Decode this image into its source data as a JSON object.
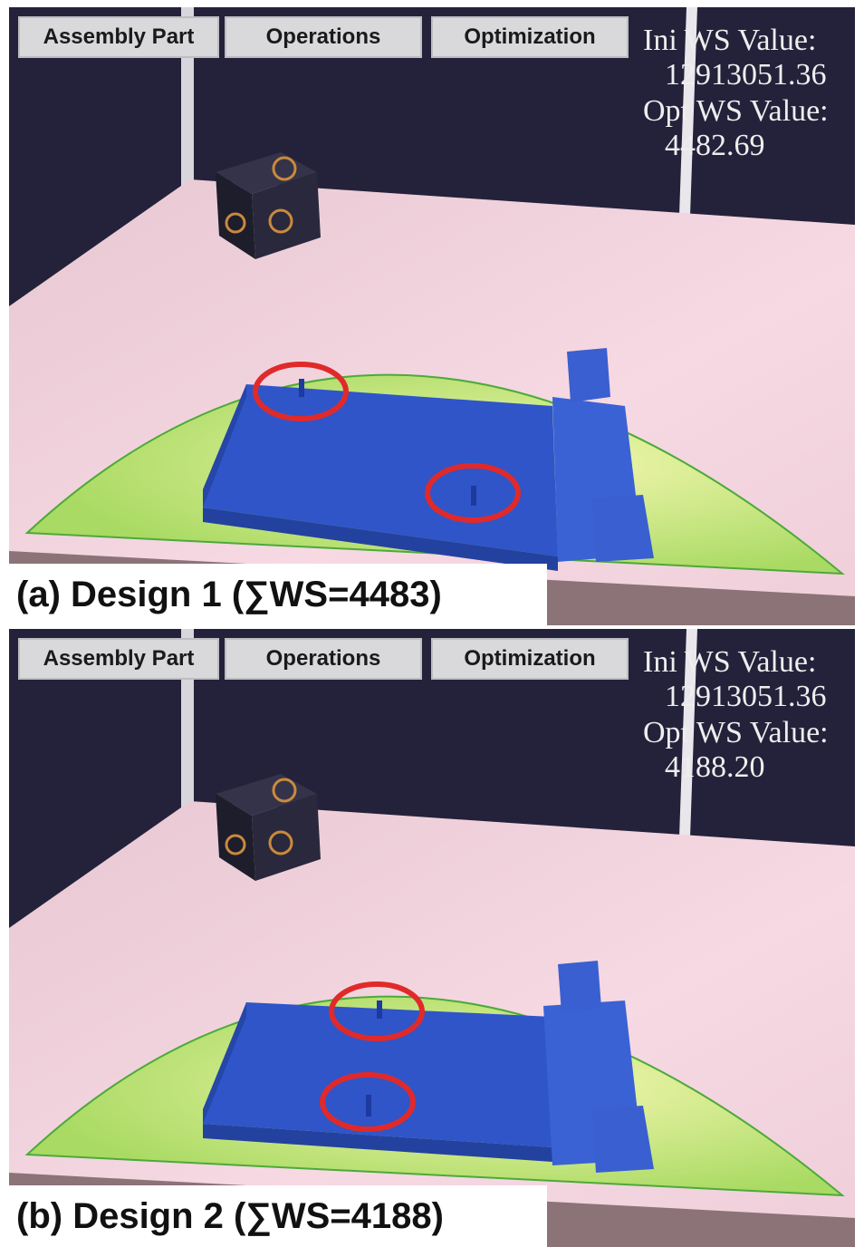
{
  "panels": [
    {
      "menu": {
        "assembly_part": "Assembly Part",
        "operations": "Operations",
        "optimization": "Optimization"
      },
      "ini_ws_label": "Ini WS Value:",
      "ini_ws_value": "12913051.36",
      "opt_ws_label": "Opt WS Value:",
      "opt_ws_value": "4482.69",
      "caption": "(a) Design 1 (∑WS=4483)"
    },
    {
      "menu": {
        "assembly_part": "Assembly Part",
        "operations": "Operations",
        "optimization": "Optimization"
      },
      "ini_ws_label": "Ini WS Value:",
      "ini_ws_value": "12913051.36",
      "opt_ws_label": "Opt WS Value:",
      "opt_ws_value": "4188.20",
      "caption": "(b) Design 2 (∑WS=4188)"
    }
  ],
  "colors": {
    "wall": "#24223a",
    "table": "#f2d2dc",
    "workspace": "#b6e276",
    "part": "#2f55c9",
    "highlight_circle": "#e02a2a"
  }
}
